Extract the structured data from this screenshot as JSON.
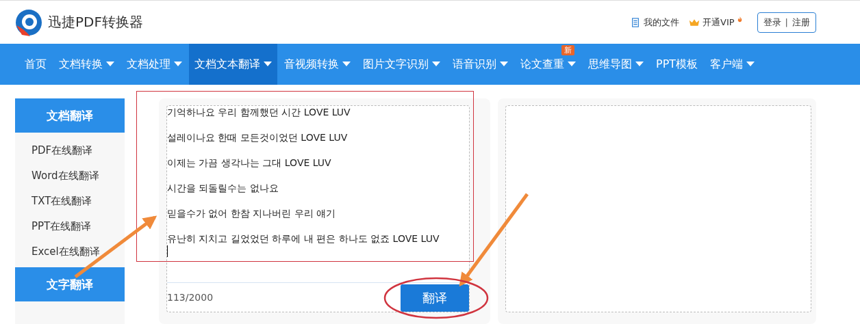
{
  "header": {
    "app_name": "迅捷PDF转换器",
    "links": [
      {
        "kind": "files",
        "label": "我的文件"
      },
      {
        "kind": "vip",
        "label": "开通VIP"
      }
    ],
    "auth": {
      "login": "登录",
      "separator": "|",
      "register": "注册"
    }
  },
  "nav": [
    {
      "label": "首页",
      "dropdown": false,
      "selected": false
    },
    {
      "label": "文档转换",
      "dropdown": true,
      "selected": false
    },
    {
      "label": "文档处理",
      "dropdown": true,
      "selected": false
    },
    {
      "label": "文档文本翻译",
      "dropdown": true,
      "selected": true
    },
    {
      "label": "音视频转换",
      "dropdown": true,
      "selected": false
    },
    {
      "label": "图片文字识别",
      "dropdown": true,
      "selected": false
    },
    {
      "label": "语音识别",
      "dropdown": true,
      "selected": false
    },
    {
      "label": "论文查重",
      "dropdown": true,
      "selected": false,
      "badge": "新"
    },
    {
      "label": "思维导图",
      "dropdown": true,
      "selected": false
    },
    {
      "label": "PPT模板",
      "dropdown": false,
      "selected": false
    },
    {
      "label": "客户端",
      "dropdown": true,
      "selected": false
    }
  ],
  "sidebar": [
    {
      "title": "文档翻译",
      "items": [
        "PDF在线翻译",
        "Word在线翻译",
        "TXT在线翻译",
        "PPT在线翻译",
        "Excel在线翻译"
      ]
    },
    {
      "title": "文字翻译"
    }
  ],
  "editor": {
    "lines": [
      "기억하나요 우리 함께했던 시간 LOVE LUV",
      "설레이나요 한때 모든것이었던 LOVE LUV",
      "이제는 가끔 생각나는 그대 LOVE LUV",
      "시간을 되돌릴수는 없나요",
      "믿을수가 없어 한참 지나버린 우리 얘기",
      "유난히 지치고 길었었던 하루에 내 편은 하나도 없죠 LOVE LUV"
    ],
    "counter": "113/2000",
    "button": "翻译"
  }
}
